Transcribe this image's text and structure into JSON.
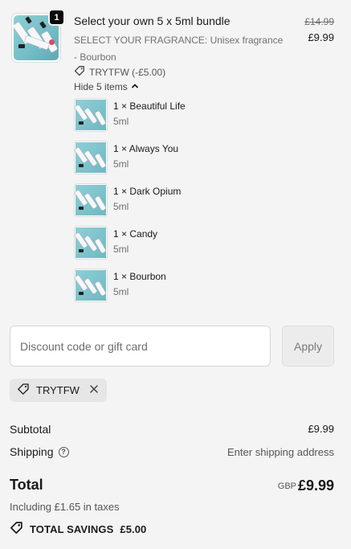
{
  "product": {
    "quantity": "1",
    "title": "Select your own 5 x 5ml bundle",
    "variant": "SELECT YOUR FRAGRANCE: Unisex fragrance - Bourbon",
    "price_original": "£14.99",
    "price_current": "£9.99",
    "discount_label": "TRYTFW (-£5.00)",
    "toggle_label": "Hide 5 items",
    "items": [
      {
        "name": "1 × Beautiful Life",
        "size": "5ml"
      },
      {
        "name": "1 × Always You",
        "size": "5ml"
      },
      {
        "name": "1 × Dark Opium",
        "size": "5ml"
      },
      {
        "name": "1 × Candy",
        "size": "5ml"
      },
      {
        "name": "1 × Bourbon",
        "size": "5ml"
      }
    ]
  },
  "discount": {
    "placeholder": "Discount code or gift card",
    "value": "",
    "apply_label": "Apply",
    "applied_code": "TRYTFW"
  },
  "summary": {
    "subtotal_label": "Subtotal",
    "subtotal_value": "£9.99",
    "shipping_label": "Shipping",
    "shipping_value": "Enter shipping address",
    "total_label": "Total",
    "currency": "GBP",
    "total_value": "£9.99",
    "tax_line": "Including £1.65 in taxes",
    "savings_label": "TOTAL SAVINGS",
    "savings_value": "£5.00"
  },
  "colors": {
    "background": "#f4f4f4",
    "text": "#1a1a1a",
    "muted": "#707070",
    "badge": "#0a0a0a",
    "chip": "#e6e6e6",
    "thumb_teal": "#8fcfd6"
  },
  "icons": {
    "discount_tag": "tag-icon",
    "toggle": "chevron-up-icon",
    "help": "question-circle-icon",
    "remove": "close-icon",
    "savings": "tag-icon"
  }
}
